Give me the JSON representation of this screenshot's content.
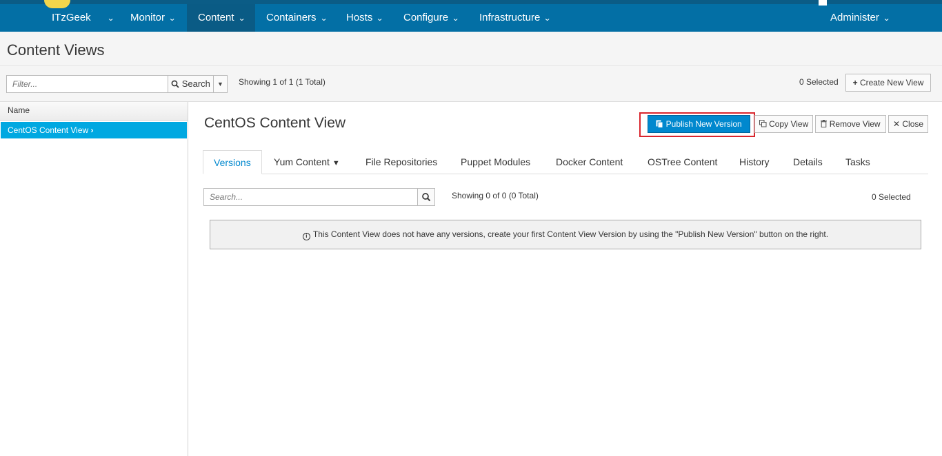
{
  "nav": {
    "items": [
      {
        "label": "ITzGeek"
      },
      {
        "label": "Monitor"
      },
      {
        "label": "Content"
      },
      {
        "label": "Containers"
      },
      {
        "label": "Hosts"
      },
      {
        "label": "Configure"
      },
      {
        "label": "Infrastructure"
      },
      {
        "label": "Administer"
      }
    ],
    "active": "Content",
    "colors": {
      "bar": "#036fa5",
      "active": "#0a5b85"
    }
  },
  "page": {
    "title": "Content Views"
  },
  "toolbar": {
    "filter_placeholder": "Filter...",
    "search_label": "Search",
    "showing": "Showing 1 of 1 (1 Total)",
    "selected": "0 Selected",
    "create_label": "Create New View"
  },
  "list": {
    "header": "Name",
    "items": [
      {
        "label": "CentOS Content View",
        "selected": true
      }
    ]
  },
  "detail": {
    "title": "CentOS Content View",
    "buttons": {
      "publish": "Publish New Version",
      "copy": "Copy View",
      "remove": "Remove View",
      "close": "Close"
    },
    "tabs": [
      {
        "label": "Versions"
      },
      {
        "label": "Yum Content"
      },
      {
        "label": "File Repositories"
      },
      {
        "label": "Puppet Modules"
      },
      {
        "label": "Docker Content"
      },
      {
        "label": "OSTree Content"
      },
      {
        "label": "History"
      },
      {
        "label": "Details"
      },
      {
        "label": "Tasks"
      }
    ],
    "active_tab": "Versions",
    "search_placeholder": "Search...",
    "showing": "Showing 0 of 0 (0 Total)",
    "selected": "0 Selected",
    "alert": "This Content View does not have any versions, create your first Content View Version by using the \"Publish New Version\" button on the right."
  },
  "colors": {
    "primary": "#0088ce",
    "selected_row": "#00a8e1",
    "highlight": "#d9252d"
  }
}
